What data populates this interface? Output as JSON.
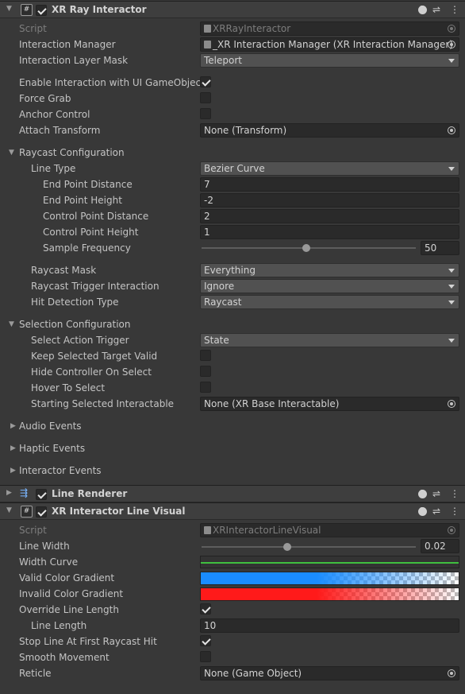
{
  "xr_ray": {
    "title": "XR Ray Interactor",
    "script_label": "Script",
    "script_value": "XRRayInteractor",
    "interaction_manager_label": "Interaction Manager",
    "interaction_manager_value": "_XR Interaction Manager (XR Interaction Manager)",
    "interaction_layer_mask_label": "Interaction Layer Mask",
    "interaction_layer_mask_value": "Teleport",
    "enable_ui_label": "Enable Interaction with UI GameObjects",
    "enable_ui_checked": true,
    "force_grab_label": "Force Grab",
    "anchor_control_label": "Anchor Control",
    "attach_transform_label": "Attach Transform",
    "attach_transform_value": "None (Transform)",
    "raycast_config_label": "Raycast Configuration",
    "line_type_label": "Line Type",
    "line_type_value": "Bezier Curve",
    "end_point_distance_label": "End Point Distance",
    "end_point_distance_value": "7",
    "end_point_height_label": "End Point Height",
    "end_point_height_value": "-2",
    "control_point_distance_label": "Control Point Distance",
    "control_point_distance_value": "2",
    "control_point_height_label": "Control Point Height",
    "control_point_height_value": "1",
    "sample_frequency_label": "Sample Frequency",
    "sample_frequency_value": "50",
    "sample_frequency_fraction": 0.49,
    "raycast_mask_label": "Raycast Mask",
    "raycast_mask_value": "Everything",
    "raycast_trigger_label": "Raycast Trigger Interaction",
    "raycast_trigger_value": "Ignore",
    "hit_detection_label": "Hit Detection Type",
    "hit_detection_value": "Raycast",
    "selection_config_label": "Selection Configuration",
    "select_action_trigger_label": "Select Action Trigger",
    "select_action_trigger_value": "State",
    "keep_selected_label": "Keep Selected Target Valid",
    "hide_controller_label": "Hide Controller On Select",
    "hover_to_select_label": "Hover To Select",
    "starting_selected_label": "Starting Selected Interactable",
    "starting_selected_value": "None (XR Base Interactable)",
    "audio_events_label": "Audio Events",
    "haptic_events_label": "Haptic Events",
    "interactor_events_label": "Interactor Events"
  },
  "line_renderer": {
    "title": "Line Renderer"
  },
  "line_visual": {
    "title": "XR Interactor Line Visual",
    "script_label": "Script",
    "script_value": "XRInteractorLineVisual",
    "line_width_label": "Line Width",
    "line_width_value": "0.02",
    "line_width_fraction": 0.4,
    "width_curve_label": "Width Curve",
    "valid_gradient_label": "Valid Color Gradient",
    "invalid_gradient_label": "Invalid Color Gradient",
    "override_length_label": "Override Line Length",
    "override_length_checked": true,
    "line_length_label": "Line Length",
    "line_length_value": "10",
    "stop_at_hit_label": "Stop Line At First Raycast Hit",
    "stop_at_hit_checked": true,
    "smooth_movement_label": "Smooth Movement",
    "reticle_label": "Reticle",
    "reticle_value": "None (Game Object)"
  },
  "icons": [
    "fold-arrow-icon",
    "script-icon",
    "help-icon",
    "preset-icon",
    "kebab-menu-icon",
    "object-picker-icon",
    "dropdown-caret-icon",
    "line-renderer-icon"
  ],
  "colors": {
    "valid_gradient": "#1a8cff",
    "invalid_gradient": "#ff1a1a",
    "curve_line": "#3fbf3f",
    "background": "#383838"
  }
}
